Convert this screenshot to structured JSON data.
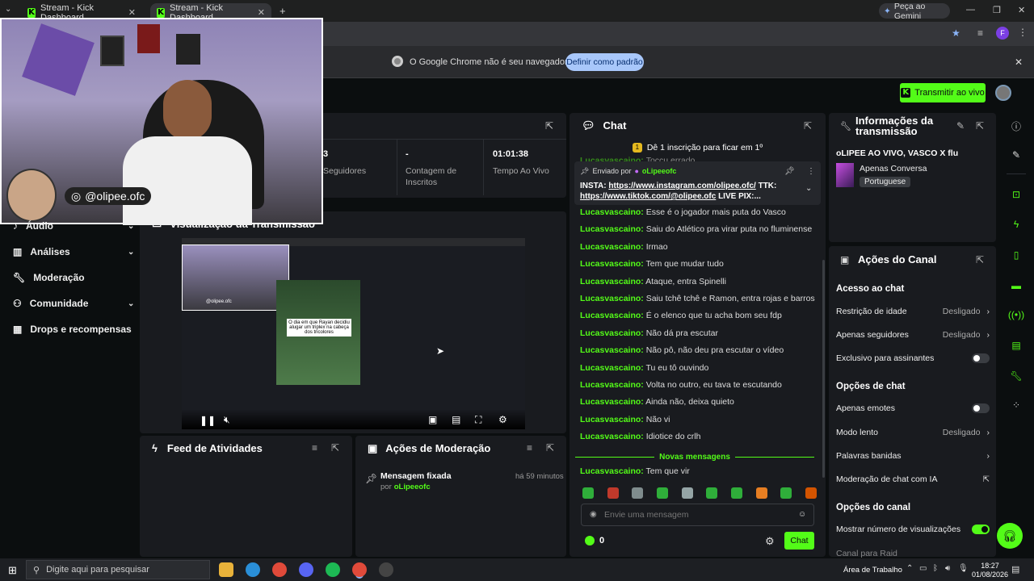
{
  "browser": {
    "tabs": [
      {
        "title": "Stream - Kick Dashboard",
        "active": false
      },
      {
        "title": "Stream - Kick Dashboard",
        "active": true
      }
    ],
    "gemini_label": "Peça ao Gemini",
    "infobar_text": "O Google Chrome não é seu navegador padrão",
    "infobar_button": "Definir como padrão",
    "profile_initial": "F"
  },
  "header": {
    "live_button": "Transmitir ao vivo"
  },
  "webcam": {
    "handle": "@olipee.ofc"
  },
  "sidebar": {
    "items": [
      {
        "label": "Áudio",
        "icon": "audio-icon",
        "chevron": true
      },
      {
        "label": "Análises",
        "icon": "analytics-icon",
        "chevron": true
      },
      {
        "label": "Moderação",
        "icon": "wrench-icon",
        "chevron": false
      },
      {
        "label": "Comunidade",
        "icon": "community-icon",
        "chevron": true
      },
      {
        "label": "Drops e recompensas",
        "icon": "drops-icon",
        "chevron": false
      }
    ]
  },
  "stats": {
    "followers_value": "3",
    "followers_label": "Seguidores",
    "subs_value": "-",
    "subs_label": "Contagem de Inscritos",
    "time_value": "01:01:38",
    "time_label": "Tempo Ao Vivo"
  },
  "preview": {
    "title": "Visualização da Transmissão",
    "inner_caption": "O dia em que Rayan decidiu alugar um triplex na cabeça dos tricolores",
    "inner_handle": "@olipee.ofc"
  },
  "activity_feed": {
    "title": "Feed de Atividades"
  },
  "mod_actions": {
    "title": "Ações de Moderação",
    "item_title": "Mensagem fixada",
    "item_by_prefix": "por",
    "item_by_user": "oLipeeofc",
    "item_time": "há 59 minutos"
  },
  "chat": {
    "title": "Chat",
    "sub_goal": "Dê 1 inscrição para ficar em 1º",
    "partial_line": "Toccu errado",
    "pinned": {
      "sent_by": "Enviado por",
      "user": "oLipeeofc",
      "prefix": "INSTA:",
      "insta_link": "https://www.instagram.com/olipee.ofc/",
      "mid": "TTK:",
      "tiktok_link": "https://www.tiktok.com/@olipee.ofc",
      "suffix": "LIVE PIX:..."
    },
    "messages": [
      {
        "user": "Lucasvascaino:",
        "text": "Esse é o jogador mais puta do Vasco"
      },
      {
        "user": "Lucasvascaino:",
        "text": "Saiu do Atlético pra virar puta no fluminense"
      },
      {
        "user": "Lucasvascaino:",
        "text": "Irmao"
      },
      {
        "user": "Lucasvascaino:",
        "text": "Tem que mudar tudo"
      },
      {
        "user": "Lucasvascaino:",
        "text": "Ataque, entra Spinelli"
      },
      {
        "user": "Lucasvascaino:",
        "text": "Saiu tchê tchê e Ramon, entra rojas e barros"
      },
      {
        "user": "Lucasvascaino:",
        "text": "É o elenco que tu acha bom seu fdp"
      },
      {
        "user": "Lucasvascaino:",
        "text": "Não dá pra escutar"
      },
      {
        "user": "Lucasvascaino:",
        "text": "Não pô, não deu pra escutar o vídeo"
      },
      {
        "user": "Lucasvascaino:",
        "text": "Tu eu tô ouvindo"
      },
      {
        "user": "Lucasvascaino:",
        "text": "Volta no outro, eu tava te escutando"
      },
      {
        "user": "Lucasvascaino:",
        "text": "Ainda não, deixa quieto"
      },
      {
        "user": "Lucasvascaino:",
        "text": "Não vi"
      },
      {
        "user": "Lucasvascaino:",
        "text": "Idiotice do crlh"
      }
    ],
    "new_messages_label": "Novas mensagens",
    "last_message": {
      "user": "Lucasvascaino:",
      "text": "Tem que vir"
    },
    "input_placeholder": "Envie uma mensagem",
    "points": "0",
    "send_button": "Chat"
  },
  "stream_info": {
    "title": "Informações da transmissão",
    "stream_title": "oLIPEE AO VIVO, VASCO X flu",
    "category": "Apenas Conversa",
    "language": "Portuguese"
  },
  "channel_actions": {
    "title": "Ações do Canal",
    "chat_access_heading": "Acesso ao chat",
    "age_restriction": {
      "label": "Restrição de idade",
      "value": "Desligado"
    },
    "followers_only": {
      "label": "Apenas seguidores",
      "value": "Desligado"
    },
    "subs_only": {
      "label": "Exclusivo para assinantes",
      "enabled": false
    },
    "chat_options_heading": "Opções de chat",
    "emotes_only": {
      "label": "Apenas emotes",
      "enabled": false
    },
    "slow_mode": {
      "label": "Modo lento",
      "value": "Desligado"
    },
    "banned_words": {
      "label": "Palavras banidas"
    },
    "ai_moderation": {
      "label": "Moderação de chat com IA"
    },
    "channel_options_heading": "Opções do canal",
    "show_views": {
      "label": "Mostrar número de visualizações",
      "enabled": true
    },
    "raid_partial": "Canal para Raid"
  },
  "taskbar": {
    "search_placeholder": "Digite aqui para pesquisar",
    "desktop_label": "Área de Trabalho",
    "time": "18:27",
    "date": "01/08/2026"
  },
  "colors": {
    "accent": "#53fc18",
    "panel": "#191b1f",
    "background": "#0b0e0f"
  }
}
